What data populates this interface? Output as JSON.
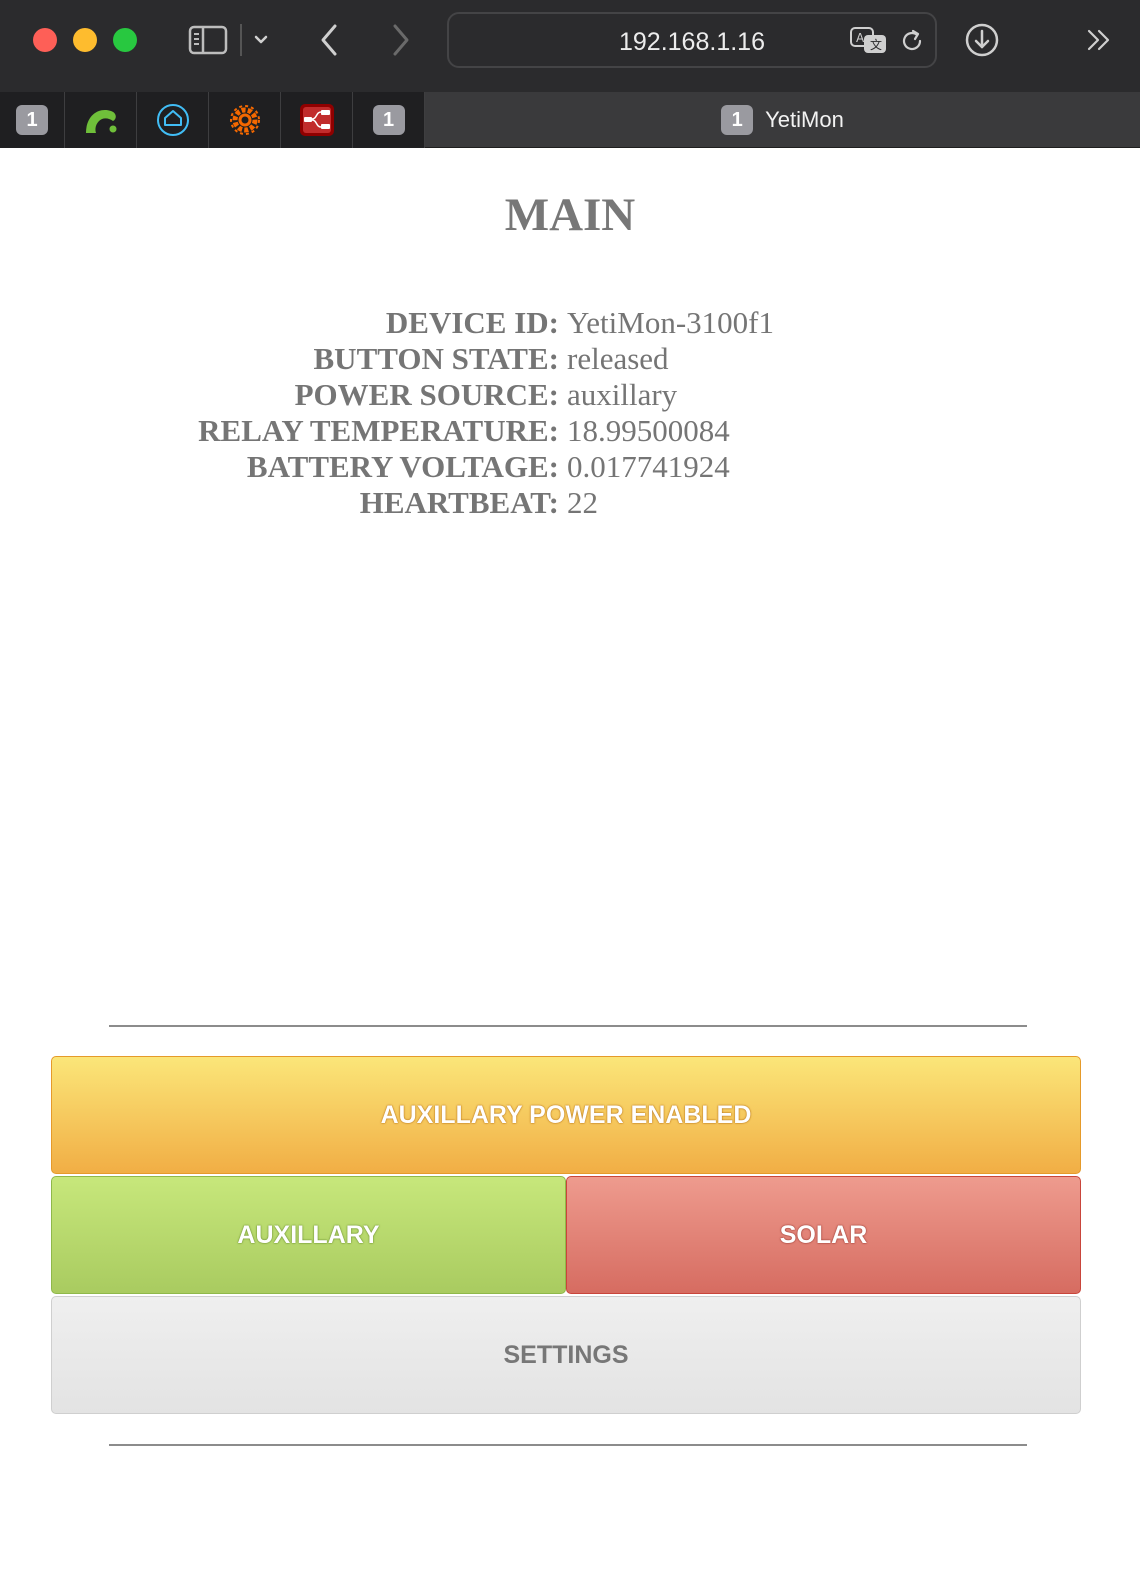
{
  "browser": {
    "url": "192.168.1.16",
    "pinned_tabs": [
      {
        "badge": "1",
        "icon": "tab-badge-icon"
      },
      {
        "icon": "green-arc-icon"
      },
      {
        "icon": "home-assistant-icon"
      },
      {
        "icon": "grafana-icon"
      },
      {
        "icon": "node-red-icon"
      },
      {
        "badge": "1",
        "icon": "tab-badge-icon"
      }
    ],
    "active_tab": {
      "badge": "1",
      "title": "YetiMon"
    }
  },
  "page": {
    "title": "MAIN",
    "info": [
      {
        "label": "DEVICE ID:",
        "value": "YetiMon-3100f1"
      },
      {
        "label": "BUTTON STATE:",
        "value": "released"
      },
      {
        "label": "POWER SOURCE:",
        "value": "auxillary"
      },
      {
        "label": "RELAY TEMPERATURE:",
        "value": "18.99500084"
      },
      {
        "label": "BATTERY VOLTAGE:",
        "value": "0.017741924"
      },
      {
        "label": "HEARTBEAT:",
        "value": "22"
      }
    ],
    "buttons": {
      "status": "AUXILLARY POWER ENABLED",
      "auxillary": "AUXILLARY",
      "solar": "SOLAR",
      "settings": "SETTINGS"
    }
  },
  "colors": {
    "status_button": "#f5c95a",
    "auxillary_button": "#b8da6c",
    "solar_button": "#e07f74",
    "settings_button": "#e8e8e8"
  }
}
